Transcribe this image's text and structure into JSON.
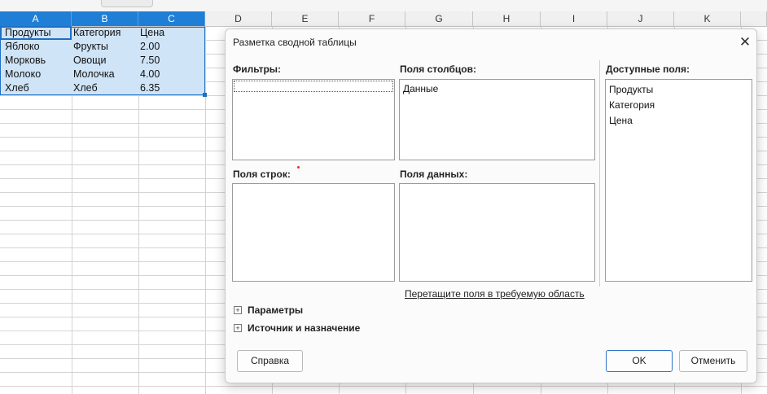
{
  "sheet": {
    "columns": [
      "A",
      "B",
      "C",
      "D",
      "E",
      "F",
      "G",
      "H",
      "I",
      "J",
      "K"
    ],
    "rows": [
      [
        "Продукты",
        "Категория",
        "Цена"
      ],
      [
        "Яблоко",
        "Фрукты",
        "2.00"
      ],
      [
        "Морковь",
        "Овощи",
        "7.50"
      ],
      [
        "Молоко",
        "Молочка",
        "4.00"
      ],
      [
        "Хлеб",
        "Хлеб",
        "6.35"
      ]
    ]
  },
  "dialog": {
    "title": "Разметка сводной таблицы",
    "filters_label": "Фильтры:",
    "column_fields_label": "Поля столбцов:",
    "row_fields_label": "Поля строк:",
    "data_fields_label": "Поля данных:",
    "available_fields_label": "Доступные поля:",
    "column_fields": [
      "Данные"
    ],
    "available_fields": [
      "Продукты",
      "Категория",
      "Цена"
    ],
    "drag_hint": "Перетащите поля в требуемую область",
    "options_label": "Параметры",
    "source_label": "Источник и назначение",
    "help_button": "Справка",
    "ok_button": "OK",
    "cancel_button": "Отменить",
    "close_glyph": "✕",
    "expand_glyph": "+"
  },
  "colors": {
    "selection_header": "#1f7fd6",
    "selection_fill": "#cfe4f7",
    "accent": "#2c75c8"
  }
}
